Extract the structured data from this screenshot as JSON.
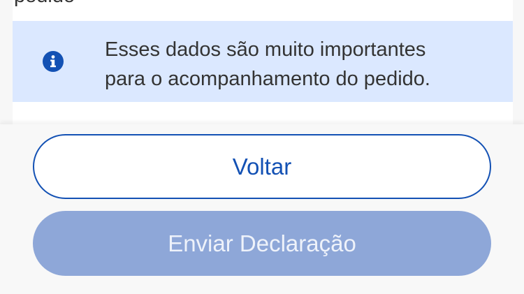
{
  "card": {
    "cut_text": "pedido"
  },
  "info": {
    "icon": "info-icon",
    "line1": "Esses dados são muito importantes",
    "line2": "para o acompanhamento do pedido."
  },
  "buttons": {
    "back_label": "Voltar",
    "send_label": "Enviar Declaração",
    "send_disabled": true
  },
  "colors": {
    "primary": "#1351b4",
    "banner_bg": "#dbe8ff",
    "disabled_button": "#8ea7d8"
  }
}
